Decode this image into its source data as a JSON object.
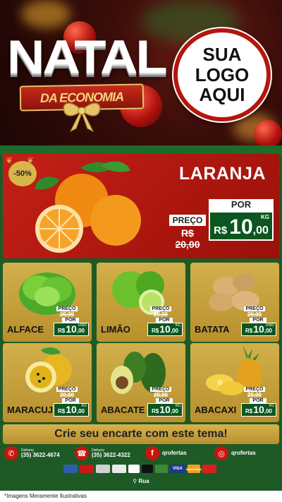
{
  "header": {
    "title_main": "NATAL",
    "title_sub": "DA ECONOMIA",
    "logo_line1": "SUA",
    "logo_line2": "LOGO",
    "logo_line3": "AQUI"
  },
  "featured": {
    "discount_badge": "-50%",
    "name": "LARANJA",
    "preco_label": "PREÇO",
    "old_price": "R$ 20,00",
    "por_label": "POR",
    "currency": "R$",
    "price_int": "10",
    "price_dec": ",00",
    "unit": "KG"
  },
  "products": [
    {
      "name": "ALFACE",
      "preco_label": "PREÇO",
      "old_price": "20,00",
      "por_label": "POR",
      "currency": "R$",
      "price_int": "10",
      "price_dec": ",00",
      "unit": "UNID"
    },
    {
      "name": "LIMÃO",
      "preco_label": "PREÇO",
      "old_price": "20,00",
      "por_label": "POR",
      "currency": "R$",
      "price_int": "10",
      "price_dec": ",00",
      "unit": "KG"
    },
    {
      "name": "BATATA",
      "preco_label": "PREÇO",
      "old_price": "20,00",
      "por_label": "POR",
      "currency": "R$",
      "price_int": "10",
      "price_dec": ",00",
      "unit": "UNID"
    },
    {
      "name": "MARACUJÁ",
      "preco_label": "PREÇO",
      "old_price": "20,00",
      "por_label": "POR",
      "currency": "R$",
      "price_int": "10",
      "price_dec": ",00",
      "unit": "KG"
    },
    {
      "name": "ABACATE",
      "preco_label": "PREÇO",
      "old_price": "20,00",
      "por_label": "POR",
      "currency": "R$",
      "price_int": "10",
      "price_dec": ",00",
      "unit": "KG"
    },
    {
      "name": "ABACAXI",
      "preco_label": "PREÇO",
      "old_price": "20,00",
      "por_label": "POR",
      "currency": "R$",
      "price_int": "10",
      "price_dec": ",00",
      "unit": "KG"
    }
  ],
  "cta": "Crie seu encarte com este tema!",
  "contacts": {
    "whatsapp_label": "Delivery",
    "whatsapp_number": "(35) 3622-4674",
    "phone_label": "Delivery",
    "phone_number": "(35) 3622-4322",
    "facebook": "qrofertas",
    "instagram": "qrofertas"
  },
  "payments": [
    "VISA",
    "MasterCard"
  ],
  "address": "Rua",
  "footer_note": "*Imagens Meramente Ilustrativas",
  "colors": {
    "red": "#c42016",
    "gold": "#d2b04c",
    "green": "#0c5620",
    "bg_green": "#1e5a25"
  }
}
